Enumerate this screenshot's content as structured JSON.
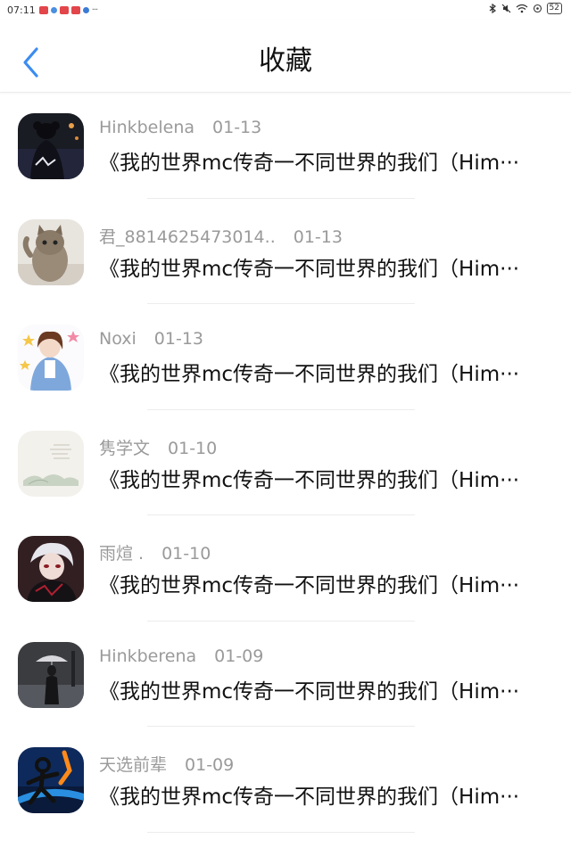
{
  "status_bar": {
    "time": "07:11",
    "more": "···",
    "battery": "52",
    "app_icon_colors": [
      "#e2454a",
      "#4a8fe0",
      "#e2454a",
      "#e2454a",
      "#3a7bd5"
    ]
  },
  "header": {
    "title": "收藏",
    "back_icon": "chevron-left-icon",
    "accent": "#3c8cf0"
  },
  "items": [
    {
      "username": "Hinkbelena",
      "date": "01-13",
      "content": "《我的世界mc传奇一不同世界的我们（Him···"
    },
    {
      "username": "君_8814625473014..",
      "date": "01-13",
      "content": "《我的世界mc传奇一不同世界的我们（Him···"
    },
    {
      "username": "Noxi",
      "date": "01-13",
      "content": "《我的世界mc传奇一不同世界的我们（Him···"
    },
    {
      "username": "隽学文",
      "date": "01-10",
      "content": "《我的世界mc传奇一不同世界的我们（Him···"
    },
    {
      "username": "雨煊 .",
      "date": "01-10",
      "content": "《我的世界mc传奇一不同世界的我们（Him···"
    },
    {
      "username": "Hinkberena",
      "date": "01-09",
      "content": "《我的世界mc传奇一不同世界的我们（Him···"
    },
    {
      "username": "天选前辈",
      "date": "01-09",
      "content": "《我的世界mc传奇一不同世界的我们（Him···"
    }
  ]
}
